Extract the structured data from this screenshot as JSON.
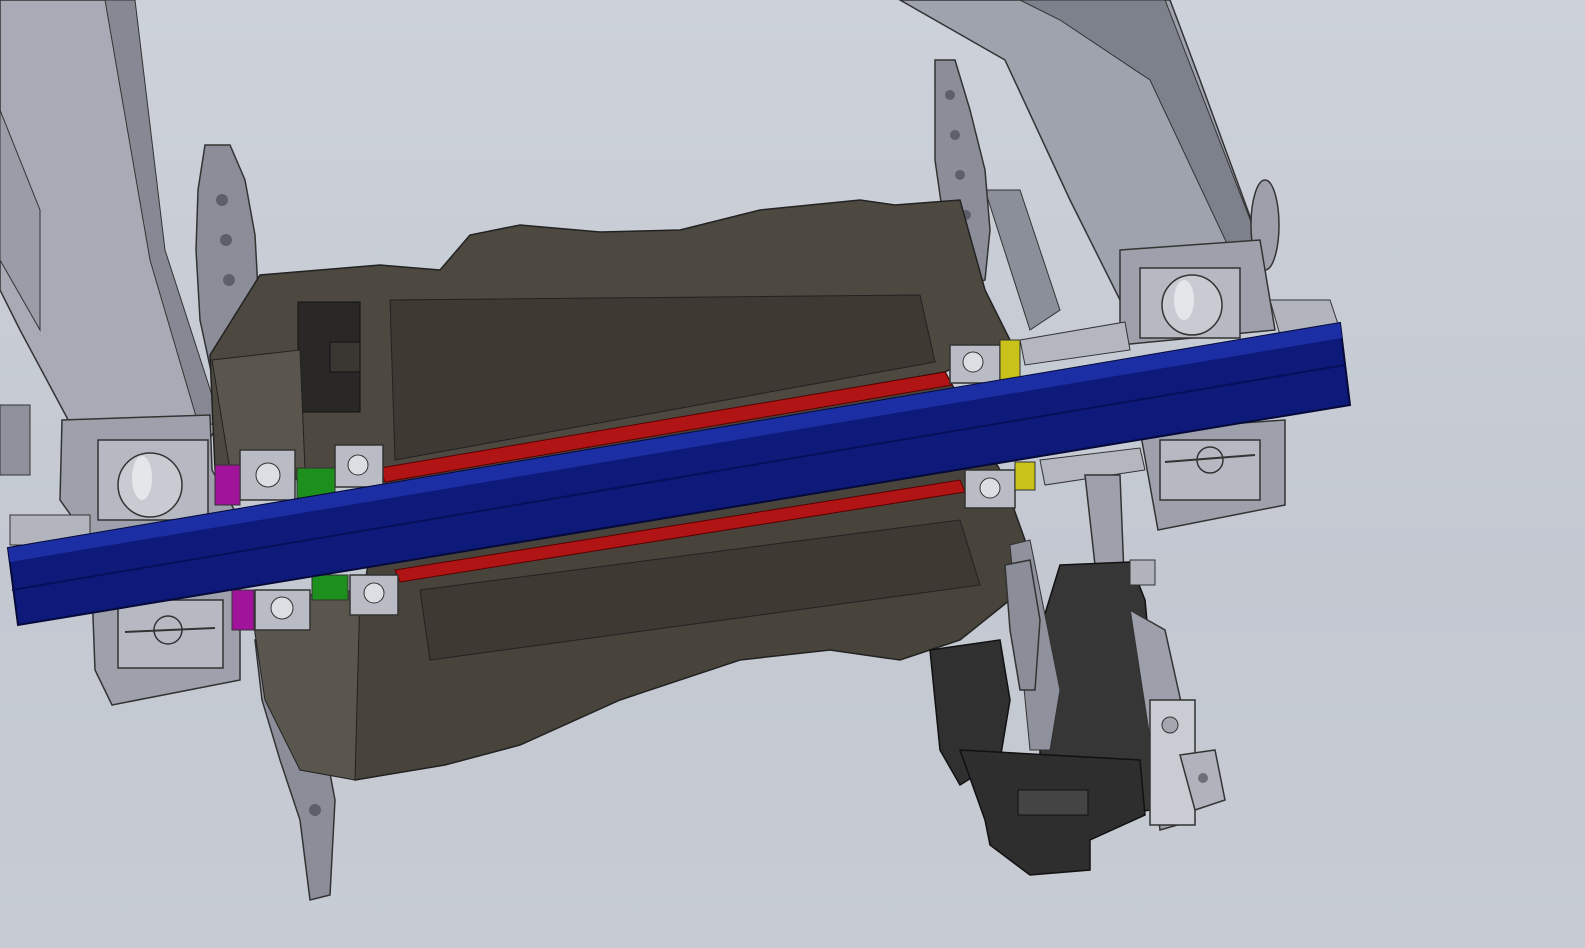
{
  "viewport": {
    "background": "#c7ccd4"
  },
  "colors": {
    "axle": "#0d1a7a",
    "axle_highlight": "#1c2ea3",
    "sleeve": "#b01414",
    "hub_body": "#4a463e",
    "hub_dark": "#3a362f",
    "arm_light": "#a9acb6",
    "arm_shadow": "#7c7f89",
    "bearing": "#b9bcc4",
    "bracket_dark": "#3d3d3d",
    "spacer_magenta": "#a0139a",
    "spacer_green": "#1c8f1c",
    "spacer_yellow": "#c8c21a"
  }
}
